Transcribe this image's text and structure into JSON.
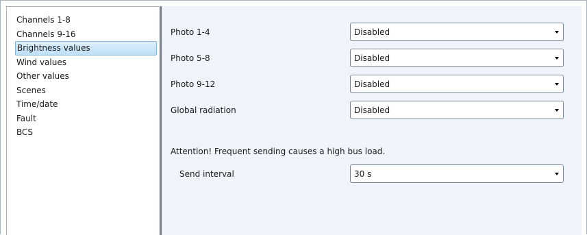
{
  "sidebar": {
    "items": [
      {
        "label": "Channels 1-8"
      },
      {
        "label": "Channels 9-16"
      },
      {
        "label": "Brightness values"
      },
      {
        "label": "Wind values"
      },
      {
        "label": "Other values"
      },
      {
        "label": "Scenes"
      },
      {
        "label": "Time/date"
      },
      {
        "label": "Fault"
      },
      {
        "label": "BCS"
      }
    ],
    "selected_index": 2
  },
  "main": {
    "params": [
      {
        "label": "Photo 1-4",
        "value": "Disabled"
      },
      {
        "label": "Photo 5-8",
        "value": "Disabled"
      },
      {
        "label": "Photo 9-12",
        "value": "Disabled"
      },
      {
        "label": "Global radiation",
        "value": "Disabled"
      }
    ],
    "note": "Attention! Frequent sending causes a high bus load.",
    "send_interval": {
      "label": "Send interval",
      "value": "30 s"
    }
  },
  "colors": {
    "panel_background": "#f0f4fa",
    "selection_background": "#cde8f9",
    "selection_border": "#88b6da"
  },
  "icons": {
    "dropdown": "chevron-down-icon"
  }
}
